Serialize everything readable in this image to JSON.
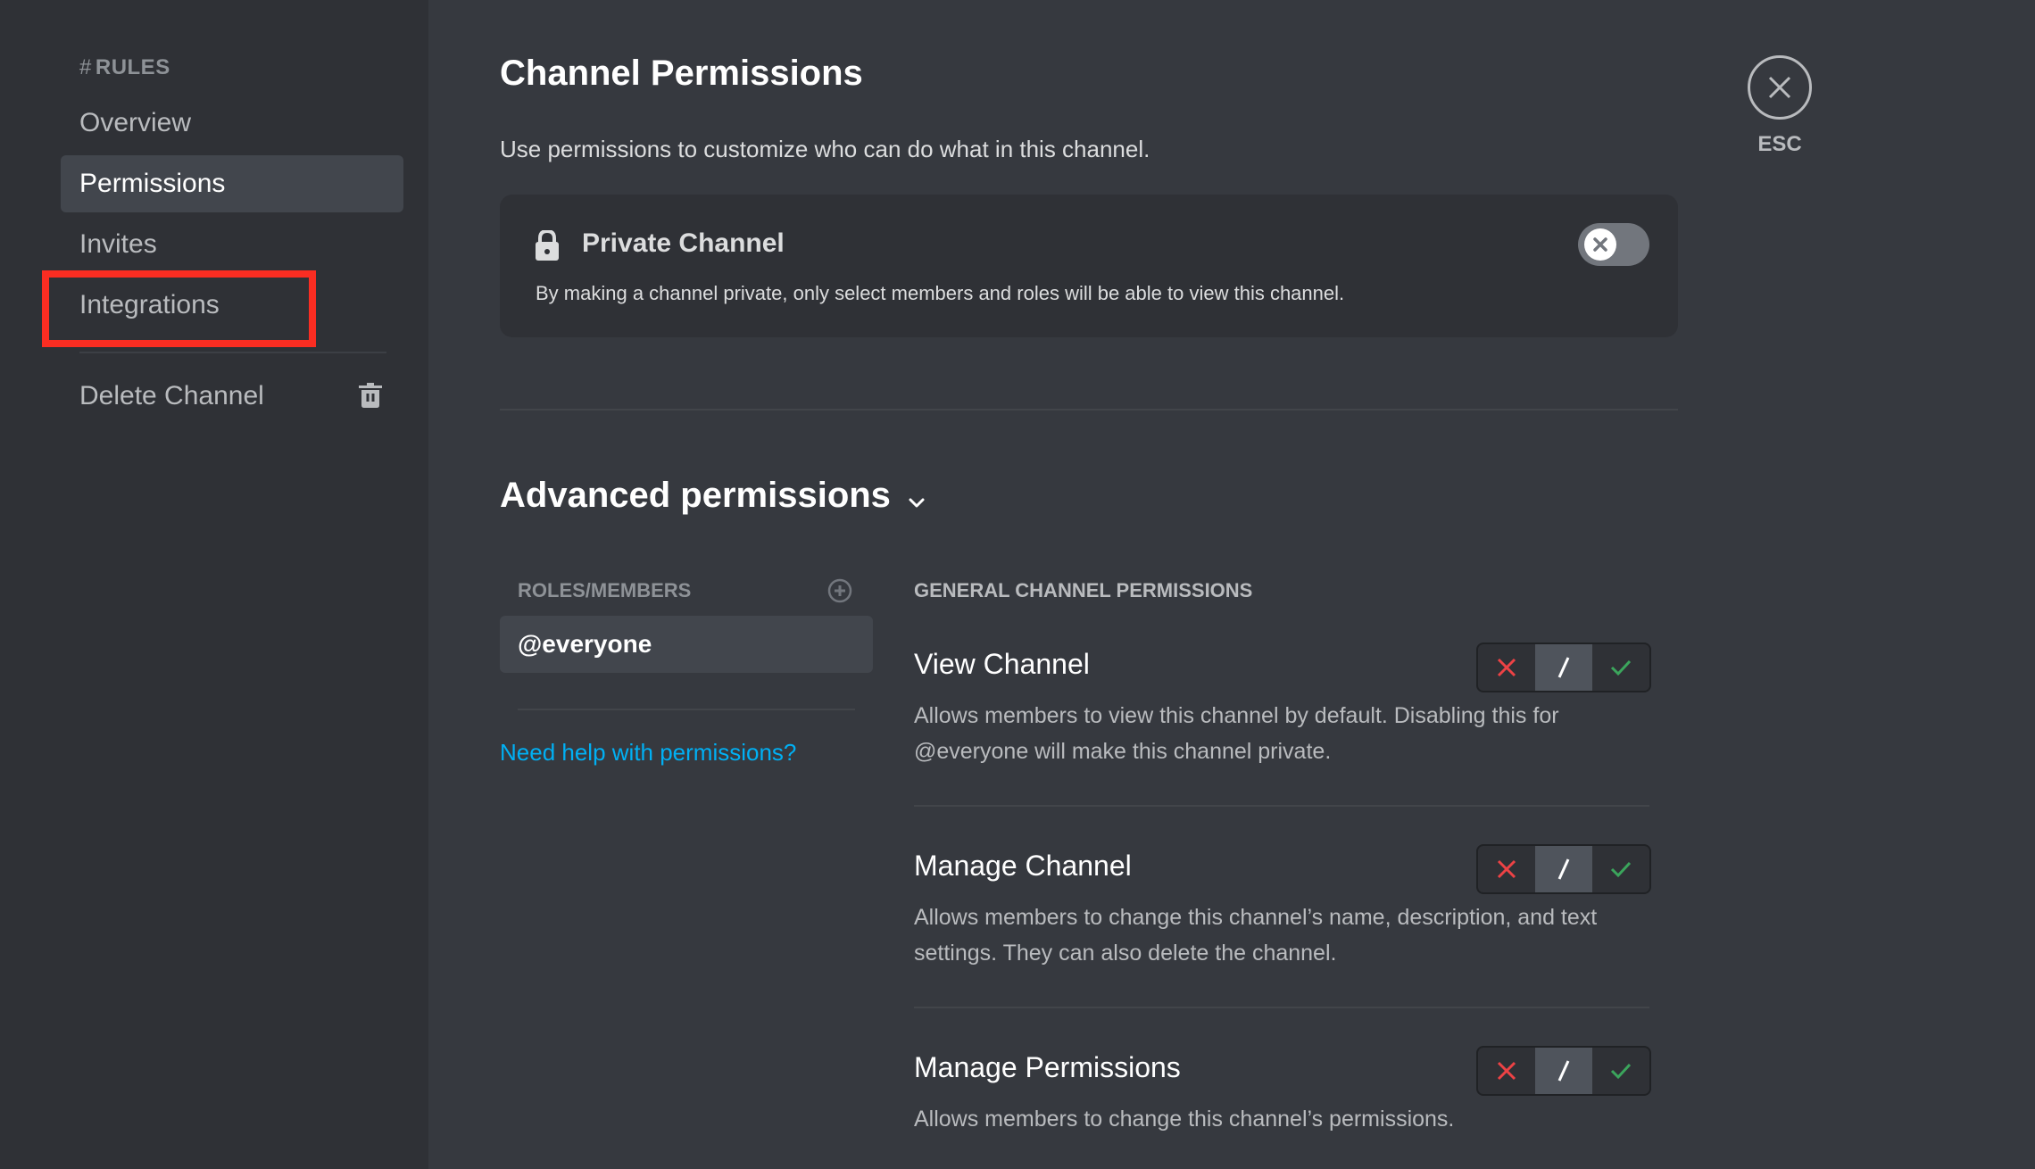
{
  "sidebar": {
    "header_hash": "#",
    "header_channel": "RULES",
    "items": [
      {
        "label": "Overview",
        "active": false
      },
      {
        "label": "Permissions",
        "active": true
      },
      {
        "label": "Invites",
        "active": false
      },
      {
        "label": "Integrations",
        "active": false,
        "highlighted": true
      }
    ],
    "delete_label": "Delete Channel"
  },
  "main": {
    "title": "Channel Permissions",
    "subtitle": "Use permissions to customize who can do what in this channel.",
    "private_channel": {
      "title": "Private Channel",
      "description": "By making a channel private, only select members and roles will be able to view this channel.",
      "enabled": false
    },
    "advanced": {
      "title": "Advanced permissions",
      "roles_header": "ROLES/MEMBERS",
      "roles": [
        "@everyone"
      ],
      "help_link": "Need help with permissions?",
      "section_header": "GENERAL CHANNEL PERMISSIONS",
      "permissions": [
        {
          "name": "View Channel",
          "description": "Allows members to view this channel by default. Disabling this for @everyone will make this channel private.",
          "state": "neutral"
        },
        {
          "name": "Manage Channel",
          "description": "Allows members to change this channel’s name, description, and text settings. They can also delete the channel.",
          "state": "neutral"
        },
        {
          "name": "Manage Permissions",
          "description": "Allows members to change this channel’s permissions.",
          "state": "neutral"
        }
      ]
    }
  },
  "close": {
    "label": "ESC"
  },
  "colors": {
    "deny": "#ed4245",
    "allow": "#3ba55c",
    "link": "#00b0f4",
    "highlight": "#fa2d22"
  }
}
